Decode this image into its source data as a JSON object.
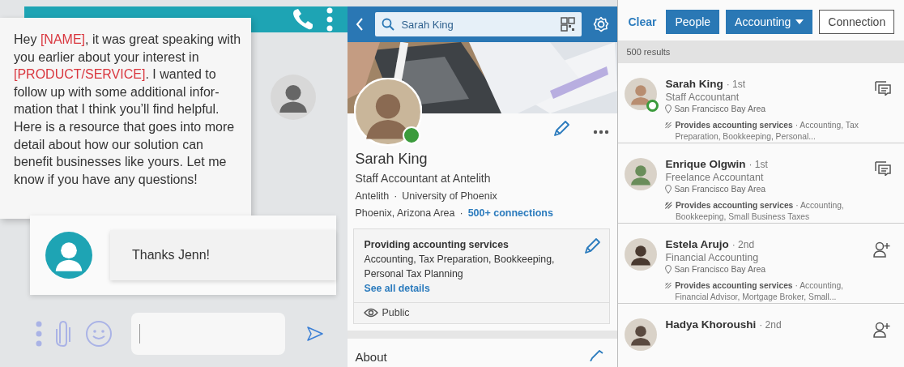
{
  "chat": {
    "message": {
      "segments": [
        {
          "text": "Hey ",
          "highlighted": false
        },
        {
          "text": "[NAME]",
          "highlighted": true
        },
        {
          "text": ", it was great speaking with you earlier about your interest in ",
          "highlighted": false
        },
        {
          "text": "[PRODUCT/SERVICE]",
          "highlighted": true
        },
        {
          "text": ". I wanted to follow up with some additional infor-mation that I think you’ll find helpful. Here is a resource that goes into more detail about how our solution can benefit businesses like yours. Let me know if you have any questions!",
          "highlighted": false
        }
      ]
    },
    "reply": {
      "text": "Thanks Jenn!"
    }
  },
  "profile": {
    "search": {
      "value": "Sarah King"
    },
    "online": true,
    "name": "Sarah King",
    "headline": "Staff Accountant at Antelith",
    "affiliations": [
      "Antelith",
      "·",
      "University of Phoenix"
    ],
    "location": "Phoenix, Arizona Area",
    "separator": "·",
    "connections": "500+ connections",
    "services": {
      "title": "Providing accounting services",
      "list": "Accounting, Tax Preparation, Bookkeeping, Personal Tax Planning",
      "link": "See all details",
      "visibility": "Public"
    },
    "about_heading": "About"
  },
  "search": {
    "filters": [
      {
        "label": "Clear",
        "kind": "link"
      },
      {
        "label": "People",
        "kind": "chip",
        "selected": true
      },
      {
        "label": "Accounting",
        "kind": "dropdown",
        "selected": true
      },
      {
        "label": "Connection",
        "kind": "chip",
        "selected": false
      }
    ],
    "count": "500 results",
    "results": [
      {
        "name": "Sarah King",
        "degree": "· 1st",
        "title": "Staff Accountant",
        "location": "San Francisco Bay Area",
        "services": "**Provides accounting services** · Accounting, Tax Preparation, Bookkeeping, Personal...",
        "kind": "message",
        "online": true
      },
      {
        "name": "Enrique Olgwin",
        "degree": "· 1st",
        "title": "Freelance Accountant",
        "location": "San Francisco Bay Area",
        "services": "**Provides accounting services** · Accounting, Bookkeeping, Small Business Taxes",
        "kind": "message",
        "online": false
      },
      {
        "name": "Estela Arujo",
        "degree": "· 2nd",
        "title": "Financial Accounting",
        "location": "San Francisco Bay Area",
        "services": "**Provides accounting services** · Accounting, Financial Advisor, Mortgage Broker, Small...",
        "kind": "connect",
        "online": false
      },
      {
        "name": "Hadya Khoroushi",
        "degree": "· 2nd",
        "kind": "connect",
        "online": false
      }
    ]
  }
}
